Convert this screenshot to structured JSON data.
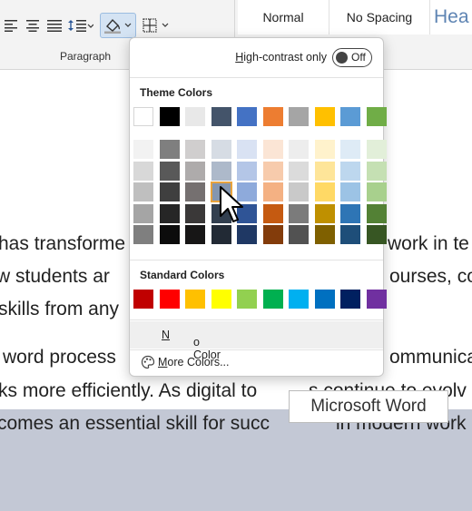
{
  "ribbon": {
    "group_label": "Paragraph",
    "icons": [
      "align-left-icon",
      "align-center-icon",
      "justify-icon",
      "line-spacing-icon",
      "shading-icon",
      "borders-icon"
    ],
    "styles": {
      "normal": "Normal",
      "no_spacing": "No Spacing",
      "heading": "Hea"
    }
  },
  "document": {
    "lines": [
      "has transforme",
      "w students ar",
      "skills from any",
      "word process",
      "ks more efficiently. As digital to",
      "comes an essential skill for succ"
    ],
    "right_fragments": [
      "work in te",
      "ourses, co",
      "ommunica",
      "s continue to evolv",
      "in modern work"
    ]
  },
  "popup": {
    "high_contrast_label_underlined": "H",
    "high_contrast_label_rest": "igh-contrast only",
    "toggle_state": "Off",
    "theme_colors_title": "Theme Colors",
    "standard_colors_title": "Standard Colors",
    "no_color_underlined": "N",
    "no_color_rest": "o Color",
    "more_colors_underlined": "M",
    "more_colors_rest": "ore Colors...",
    "theme_top_row": [
      "#ffffff",
      "#000000",
      "#e8e8e8",
      "#44546a",
      "#4472c4",
      "#ed7d31",
      "#a5a5a5",
      "#ffc000",
      "#5b9bd5",
      "#70ad47"
    ],
    "theme_shades": [
      [
        "#f2f2f2",
        "#7f7f7f",
        "#d0cece",
        "#d6dce4",
        "#d9e2f3",
        "#fbe5d5",
        "#ededed",
        "#fff2cc",
        "#deebf6",
        "#e2efd9"
      ],
      [
        "#d8d8d8",
        "#595959",
        "#aeabab",
        "#adb9ca",
        "#b4c6e7",
        "#f7cbac",
        "#dbdbdb",
        "#fee599",
        "#bdd7ee",
        "#c5e0b3"
      ],
      [
        "#bfbfbf",
        "#3f3f3f",
        "#757070",
        "#8496b0",
        "#8eaadb",
        "#f4b183",
        "#c9c9c9",
        "#ffd965",
        "#9cc3e5",
        "#a8d08d"
      ],
      [
        "#a5a5a5",
        "#262626",
        "#3a3838",
        "#323f4f",
        "#2f5496",
        "#c55a11",
        "#7b7b7b",
        "#bf9000",
        "#2e75b5",
        "#538135"
      ],
      [
        "#7f7f7f",
        "#0c0c0c",
        "#171616",
        "#222a35",
        "#1f3864",
        "#833c0b",
        "#525252",
        "#7f6000",
        "#1e4e79",
        "#375623"
      ]
    ],
    "standard_colors": [
      "#c00000",
      "#ff0000",
      "#ffc000",
      "#ffff00",
      "#92d050",
      "#00b050",
      "#00b0f0",
      "#0070c0",
      "#002060",
      "#7030a0"
    ],
    "selected_swatch": "theme-shade-r2-c3"
  },
  "tooltip": {
    "text": "Microsoft Word"
  }
}
